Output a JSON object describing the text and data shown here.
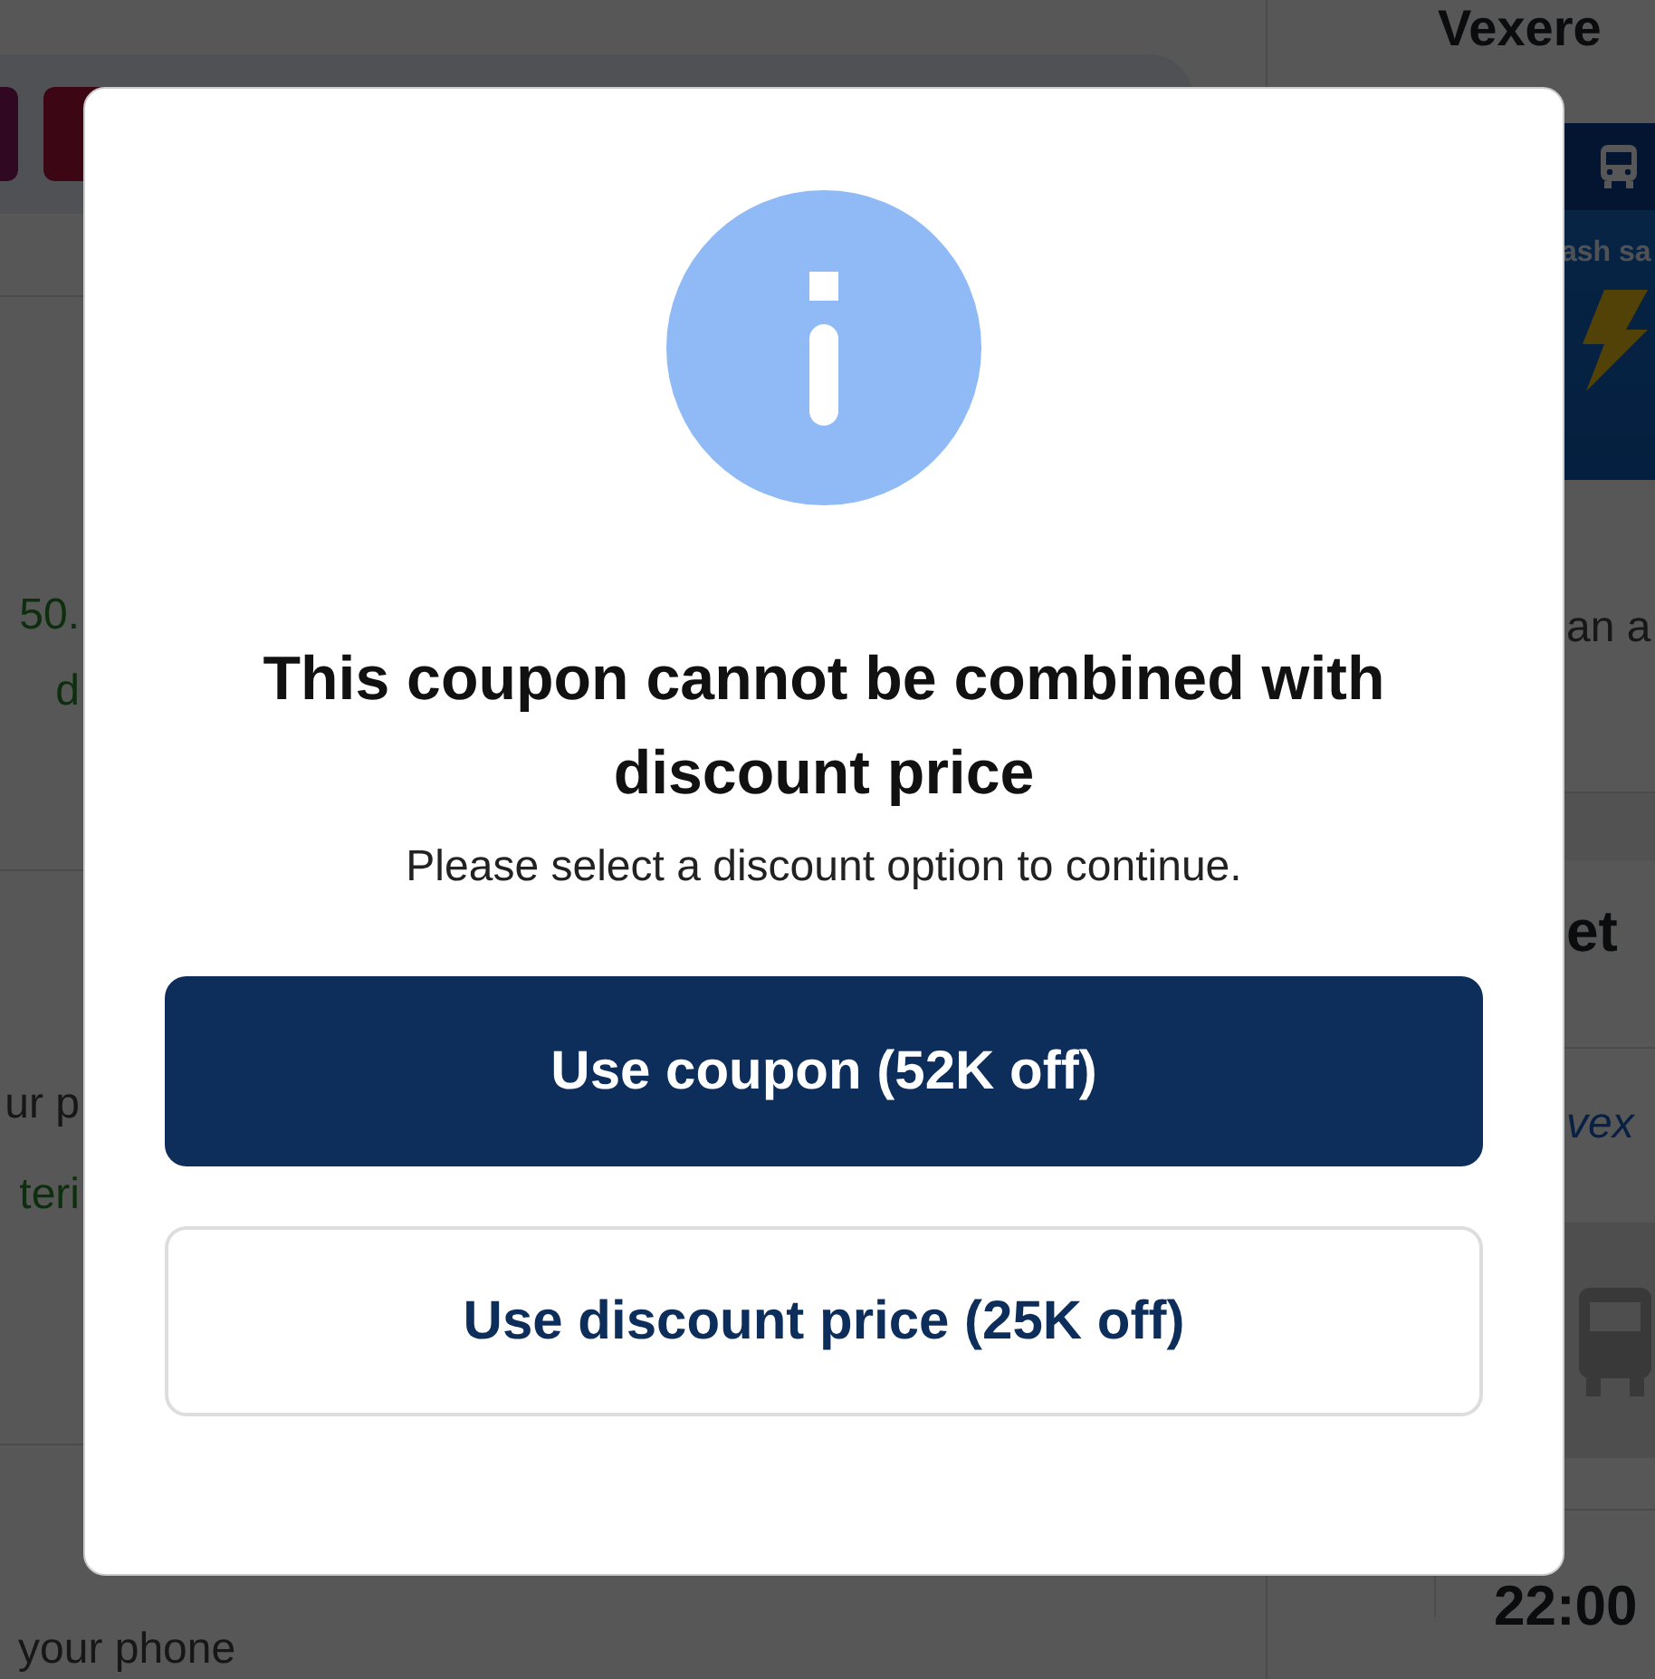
{
  "page_behind": {
    "brand": "Vexere",
    "left_texts": [
      {
        "text": "50.",
        "kind": "price"
      },
      {
        "text": "d",
        "kind": "price"
      },
      {
        "text": "ur p",
        "kind": "note"
      },
      {
        "text": "teri",
        "kind": "price"
      },
      {
        "text": "your phone",
        "kind": "note"
      }
    ],
    "banner": {
      "text": "ash sa"
    },
    "right_texts": [
      {
        "text": "an a",
        "kind": "note"
      },
      {
        "text": "et",
        "kind": "heading"
      },
      {
        "text": "vex",
        "kind": "logo"
      },
      {
        "text": "22:00",
        "kind": "time"
      }
    ]
  },
  "dialog": {
    "title": "This coupon cannot be combined with discount price",
    "message": "Please select a discount option to continue.",
    "buttons": [
      {
        "label": "Use coupon (52K off)",
        "kind": "primary"
      },
      {
        "label": "Use discount price (25K off)",
        "kind": "secondary"
      }
    ]
  }
}
